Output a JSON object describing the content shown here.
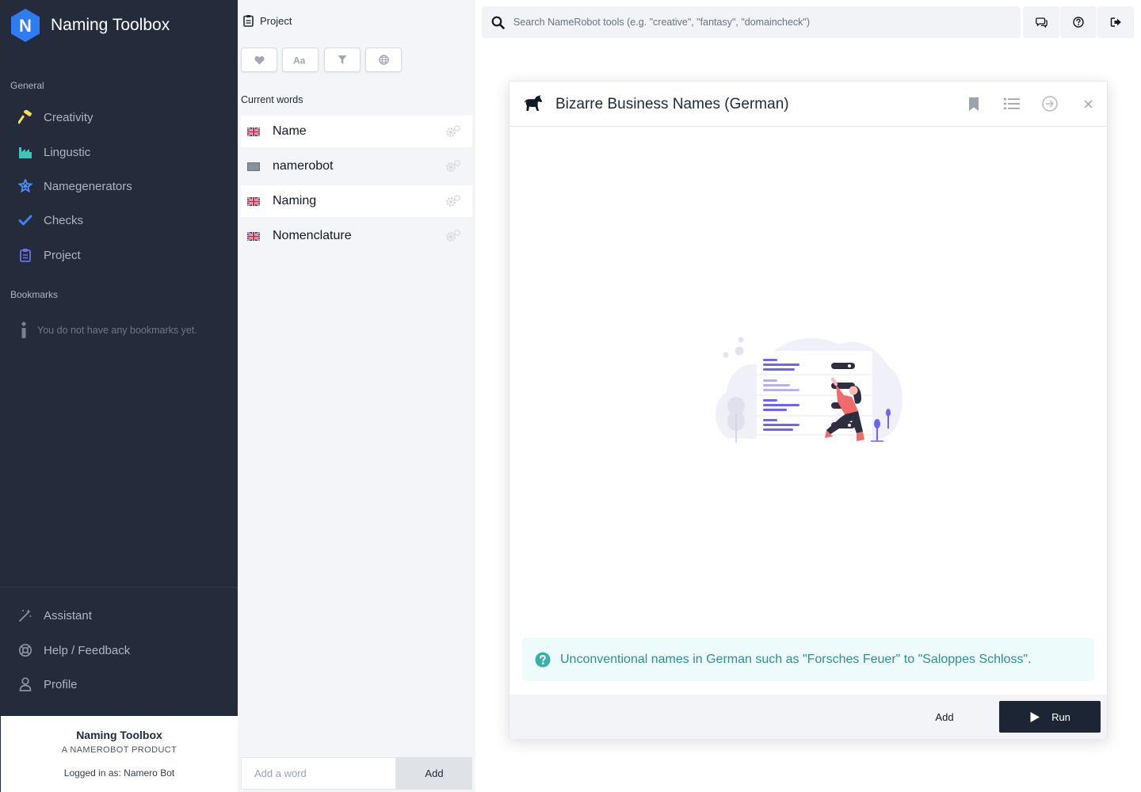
{
  "sidebar": {
    "app_name": "Naming Toolbox",
    "logo_letter": "N",
    "general_title": "General",
    "nav": [
      {
        "label": "Creativity",
        "icon": "hammer-icon",
        "color": "#f5e14a"
      },
      {
        "label": "Lingustic",
        "icon": "factory-icon",
        "color": "#3ec5bb"
      },
      {
        "label": "Namegenerators",
        "icon": "star-badge-icon",
        "color": "#4f8ff7"
      },
      {
        "label": "Checks",
        "icon": "check-icon",
        "color": "#3b82f6"
      },
      {
        "label": "Project",
        "icon": "clipboard-icon",
        "color": "#6d6ee8"
      }
    ],
    "bookmarks_title": "Bookmarks",
    "bookmarks_empty": "You do not have any bookmarks yet.",
    "bottom_nav": [
      {
        "label": "Assistant",
        "icon": "magic-wand-icon"
      },
      {
        "label": "Help / Feedback",
        "icon": "lifebuoy-icon"
      },
      {
        "label": "Profile",
        "icon": "user-icon"
      }
    ],
    "footer": {
      "title": "Naming Toolbox",
      "subtitle": "A NAMEROBOT PRODUCT",
      "logged_in": "Logged in as: Namero Bot"
    }
  },
  "project": {
    "title": "Project",
    "tools": [
      "heart-icon",
      "font-case-icon",
      "filter-icon",
      "globe-icon"
    ],
    "current_words_title": "Current words",
    "words": [
      {
        "text": "Name",
        "flag": "uk-flag-icon"
      },
      {
        "text": "namerobot",
        "flag": "generic-flag-icon"
      },
      {
        "text": "Naming",
        "flag": "uk-flag-icon"
      },
      {
        "text": "Nomenclature",
        "flag": "uk-flag-icon"
      }
    ],
    "add_word_placeholder": "Add a word",
    "add_button": "Add"
  },
  "search": {
    "placeholder": "Search NameRobot tools (e.g. \"creative\", \"fantasy\", \"domaincheck\")"
  },
  "top_buttons": [
    "chat-icon",
    "help-circle-icon",
    "logout-icon"
  ],
  "modal": {
    "title": "Bizarre Business Names (German)",
    "icon": "horse-icon",
    "description": "Unconventional names in German such as \"Forsches Feuer\" to \"Saloppes Schloss\".",
    "add_label": "Add",
    "run_label": "Run"
  },
  "colors": {
    "sidebar_bg": "#242c3b",
    "accent_blue": "#2e7bf2",
    "info_bg": "#eefbfb",
    "info_text": "#2f8f8a",
    "run_bg": "#1c2533",
    "illustration_purple": "#6c63ff",
    "illustration_coral": "#f26b6b"
  }
}
